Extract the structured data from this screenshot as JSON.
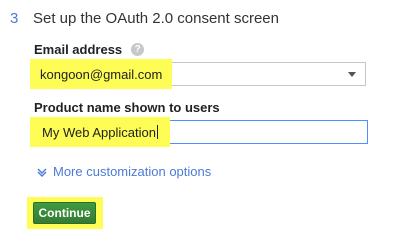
{
  "step": {
    "number": "3",
    "title": "Set up the OAuth 2.0 consent screen"
  },
  "email": {
    "label": "Email address",
    "help_icon": "?",
    "value": "kongoon@gmail.com"
  },
  "product": {
    "label": "Product name shown to users",
    "value": "My Web Application"
  },
  "more_options": {
    "icon": "chevron-down-icon",
    "label": "More customization options"
  },
  "continue_button": {
    "label": "Continue"
  },
  "colors": {
    "link": "#4d7bd5",
    "highlight": "#fdfd55",
    "button": "#3d8b3d",
    "focus_border": "#4d90fe"
  }
}
